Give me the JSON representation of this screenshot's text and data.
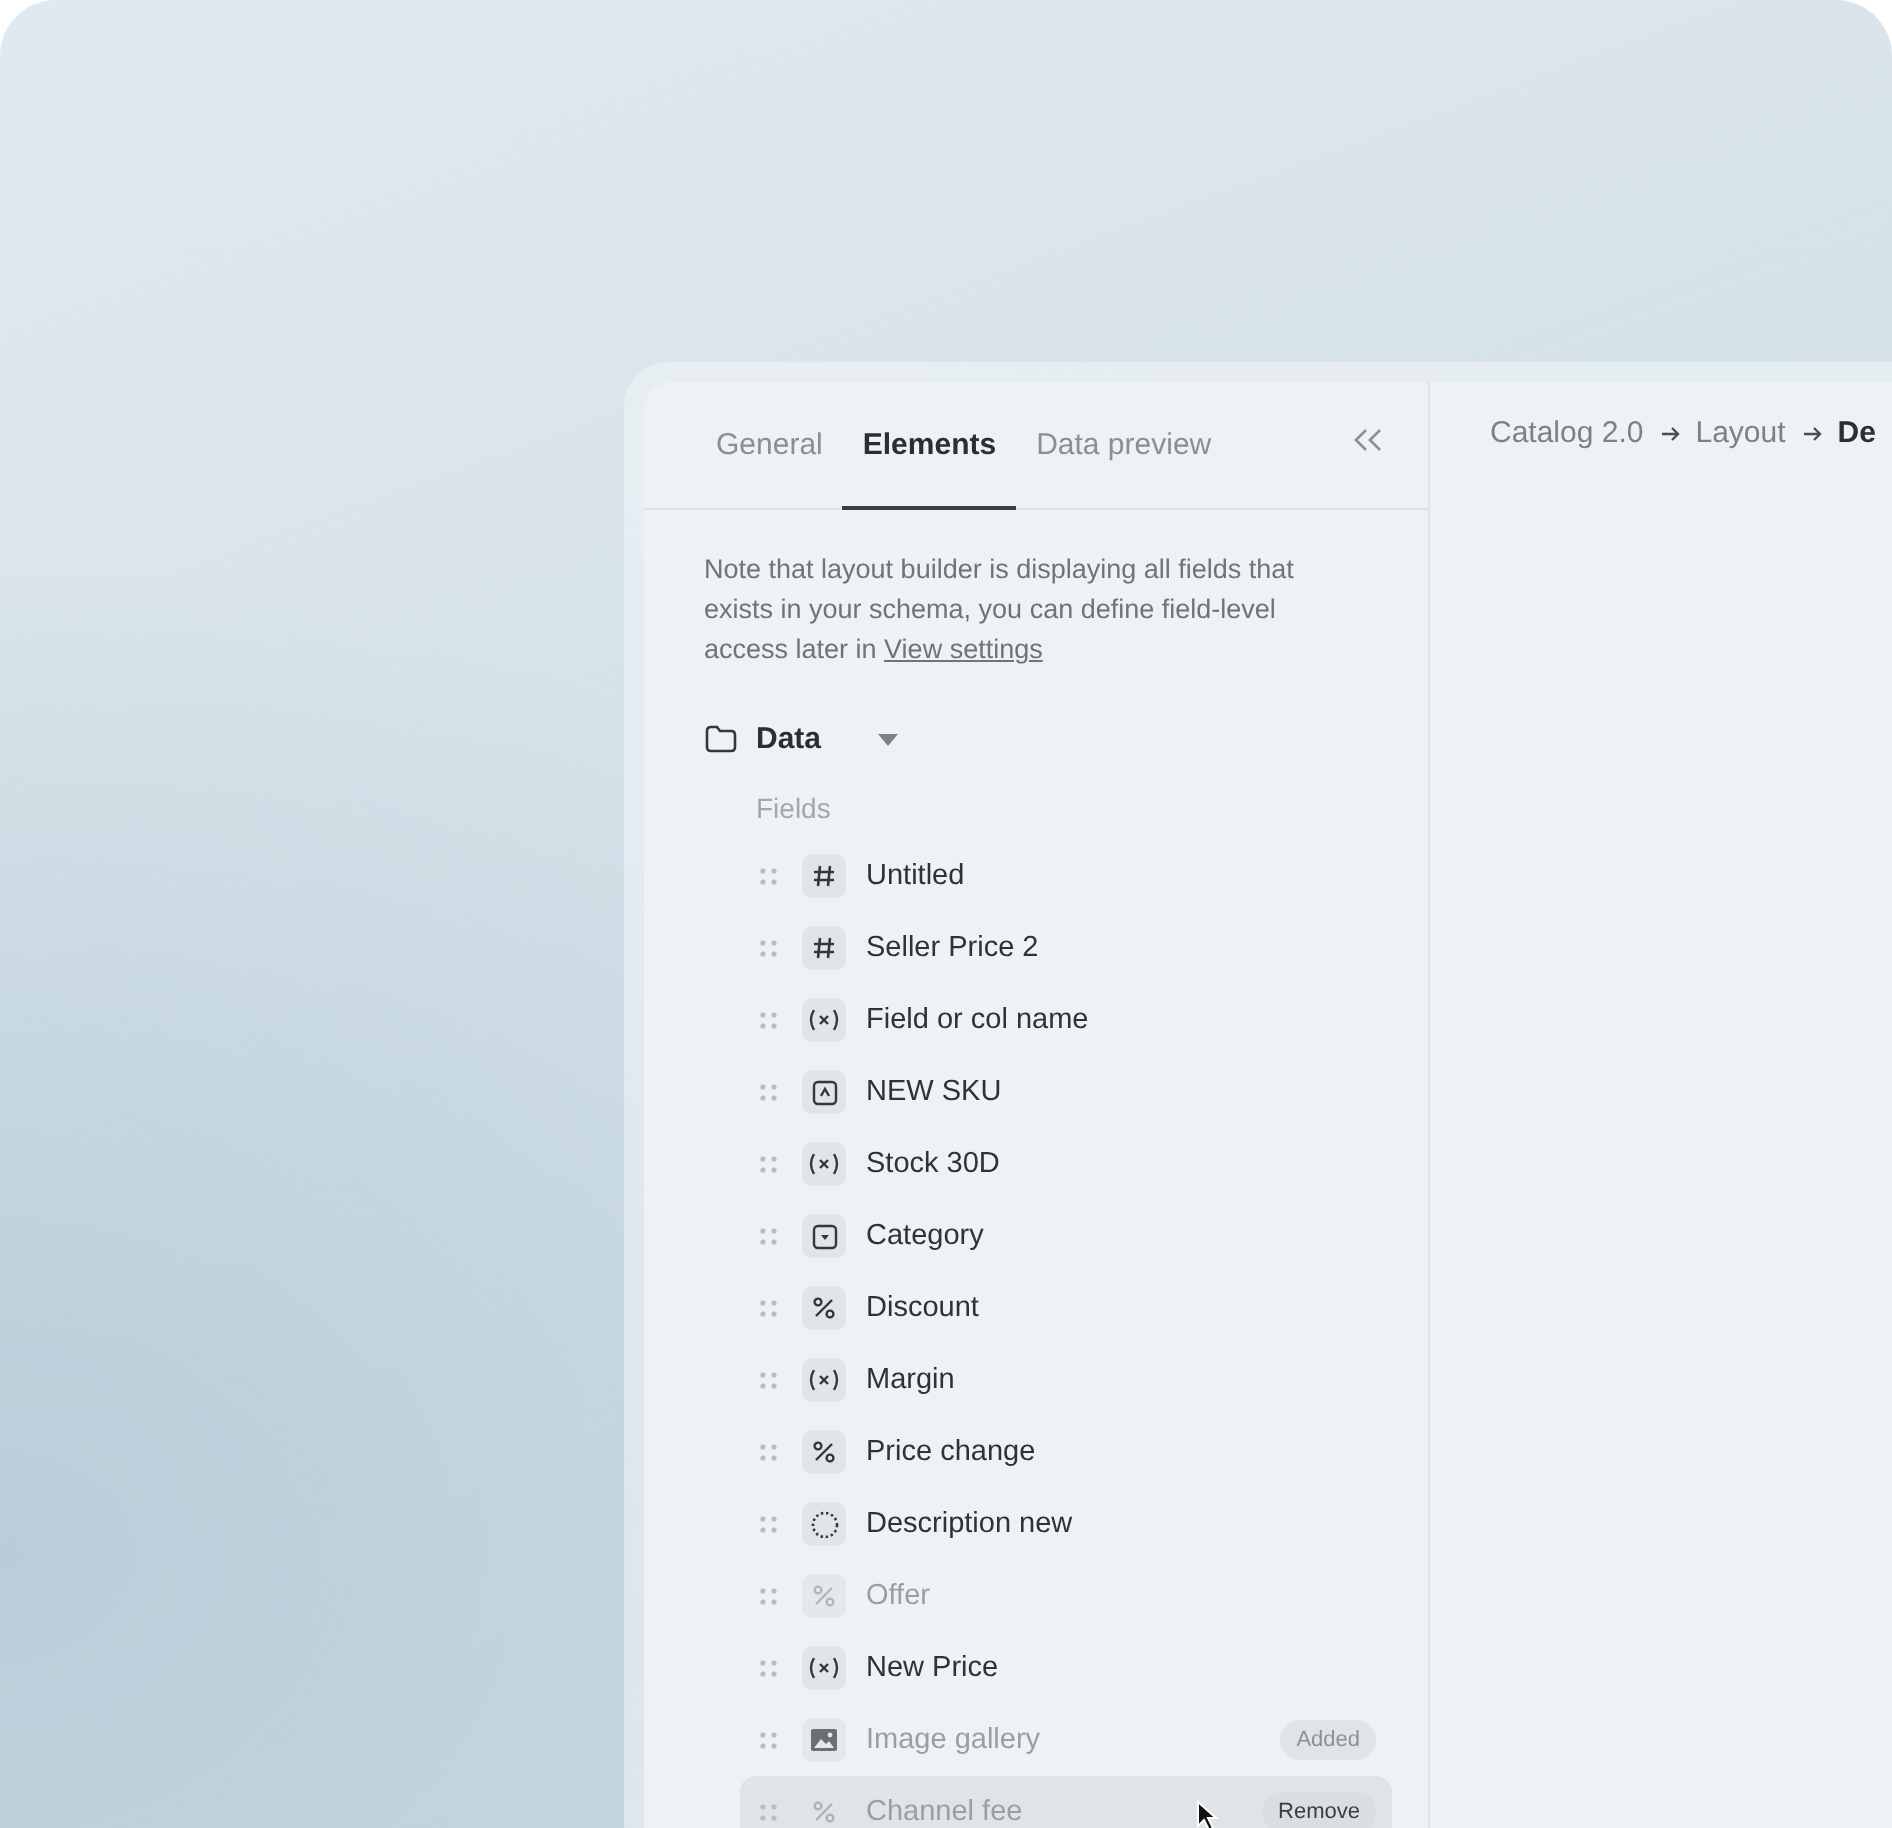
{
  "tabs": [
    {
      "label": "General",
      "selected": false
    },
    {
      "label": "Elements",
      "selected": true
    },
    {
      "label": "Data preview",
      "selected": false
    }
  ],
  "breadcrumb": [
    {
      "label": "Catalog 2.0",
      "current": false
    },
    {
      "label": "Layout",
      "current": false
    },
    {
      "label": "De",
      "current": true
    }
  ],
  "note": {
    "text": "Note that layout builder is displaying all fields that exists in your schema, you can define field-level access later in ",
    "link": "View settings"
  },
  "group": {
    "label": "Data",
    "expanded": true
  },
  "section_label": "Fields",
  "fields": [
    {
      "kind": "number",
      "label": "Untitled",
      "dimmed": false,
      "hovered": false
    },
    {
      "kind": "number",
      "label": "Seller Price 2",
      "dimmed": false,
      "hovered": false
    },
    {
      "kind": "variable",
      "label": "Field or col name",
      "dimmed": false,
      "hovered": false
    },
    {
      "kind": "text",
      "label": "NEW SKU",
      "dimmed": false,
      "hovered": false
    },
    {
      "kind": "variable",
      "label": "Stock 30D",
      "dimmed": false,
      "hovered": false
    },
    {
      "kind": "select",
      "label": "Category",
      "dimmed": false,
      "hovered": false
    },
    {
      "kind": "percent",
      "label": "Discount",
      "dimmed": false,
      "hovered": false
    },
    {
      "kind": "variable",
      "label": "Margin",
      "dimmed": false,
      "hovered": false
    },
    {
      "kind": "percent",
      "label": "Price change",
      "dimmed": false,
      "hovered": false
    },
    {
      "kind": "rich",
      "label": "Description new",
      "dimmed": false,
      "hovered": false
    },
    {
      "kind": "percent",
      "label": "Offer",
      "dimmed": true,
      "hovered": false
    },
    {
      "kind": "variable",
      "label": "New Price",
      "dimmed": false,
      "hovered": false
    },
    {
      "kind": "image",
      "label": "Image gallery",
      "dimmed": true,
      "hovered": false,
      "badge": "Added"
    },
    {
      "kind": "percent",
      "label": "Channel fee",
      "dimmed": true,
      "hovered": true,
      "action": "Remove"
    }
  ]
}
